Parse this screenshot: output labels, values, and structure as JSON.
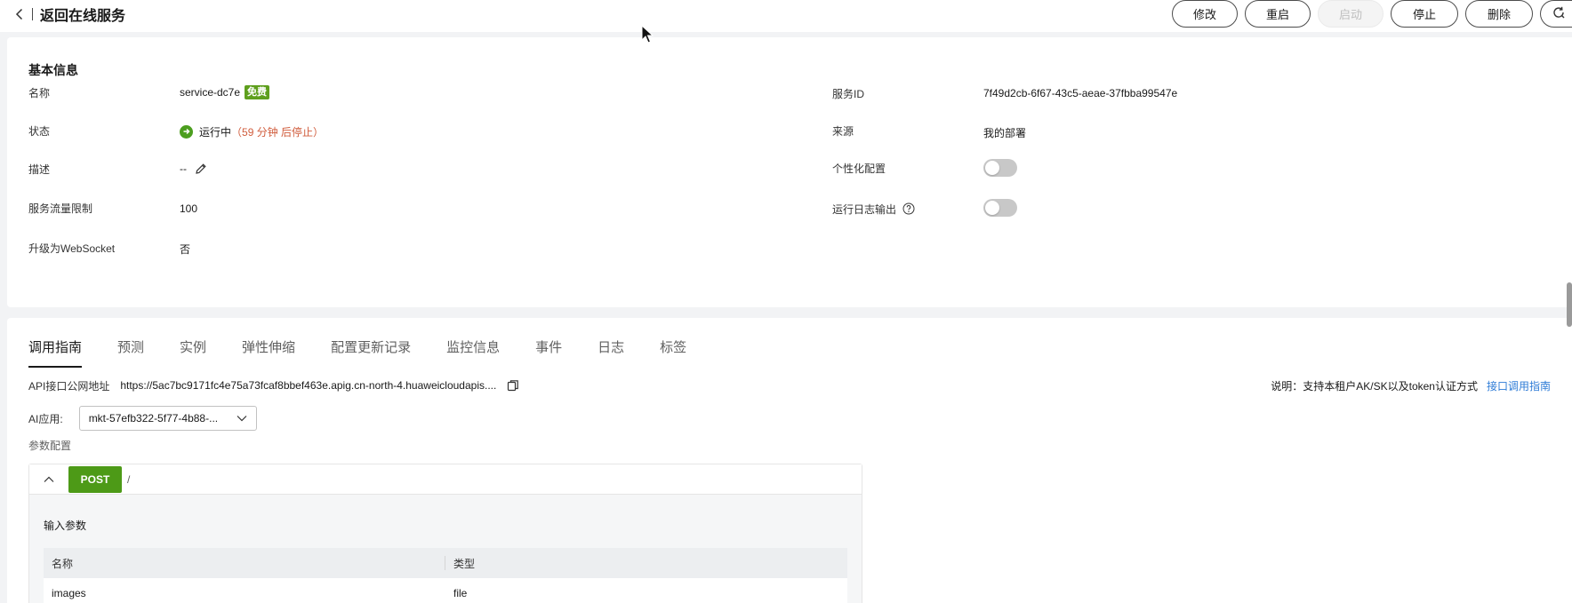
{
  "header": {
    "back_title": "返回在线服务",
    "actions": {
      "edit": "修改",
      "restart": "重启",
      "start": "启动",
      "stop": "停止",
      "delete": "删除"
    }
  },
  "basic_info": {
    "title": "基本信息",
    "left": {
      "name_label": "名称",
      "name_value": "service-dc7e",
      "name_badge": "免费",
      "status_label": "状态",
      "status_value": "运行中",
      "status_extra": "（59 分钟 后停止）",
      "desc_label": "描述",
      "desc_value": "--",
      "flow_label": "服务流量限制",
      "flow_value": "100",
      "ws_label": "升级为WebSocket",
      "ws_value": "否"
    },
    "right": {
      "id_label": "服务ID",
      "id_value": "7f49d2cb-6f67-43c5-aeae-37fbba99547e",
      "source_label": "来源",
      "source_value": "我的部署",
      "custom_label": "个性化配置",
      "log_label": "运行日志输出"
    },
    "toggles": {
      "custom_config_on": false,
      "run_log_on": false
    }
  },
  "guide": {
    "tabs": [
      "调用指南",
      "预测",
      "实例",
      "弹性伸缩",
      "配置更新记录",
      "监控信息",
      "事件",
      "日志",
      "标签"
    ],
    "active_tab": 0,
    "api_label": "API接口公网地址",
    "api_url": "https://5ac7bc9171fc4e75a73fcaf8bbef463e.apig.cn-north-4.huaweicloudapis....",
    "note_text": "说明：支持本租户AK/SK以及token认证方式",
    "note_link": "接口调用指南",
    "ai_label": "AI应用:",
    "ai_value": "mkt-57efb322-5f77-4b88-...",
    "param_label": "参数配置",
    "method": "POST",
    "path": "/",
    "input_label": "输入参数",
    "table": {
      "headers": [
        "名称",
        "类型"
      ],
      "rows": [
        [
          "images",
          "file"
        ]
      ]
    }
  },
  "colors": {
    "accent_green": "#4d9a17",
    "link_blue": "#2d7bd6",
    "warning_orange": "#d05c3c"
  }
}
